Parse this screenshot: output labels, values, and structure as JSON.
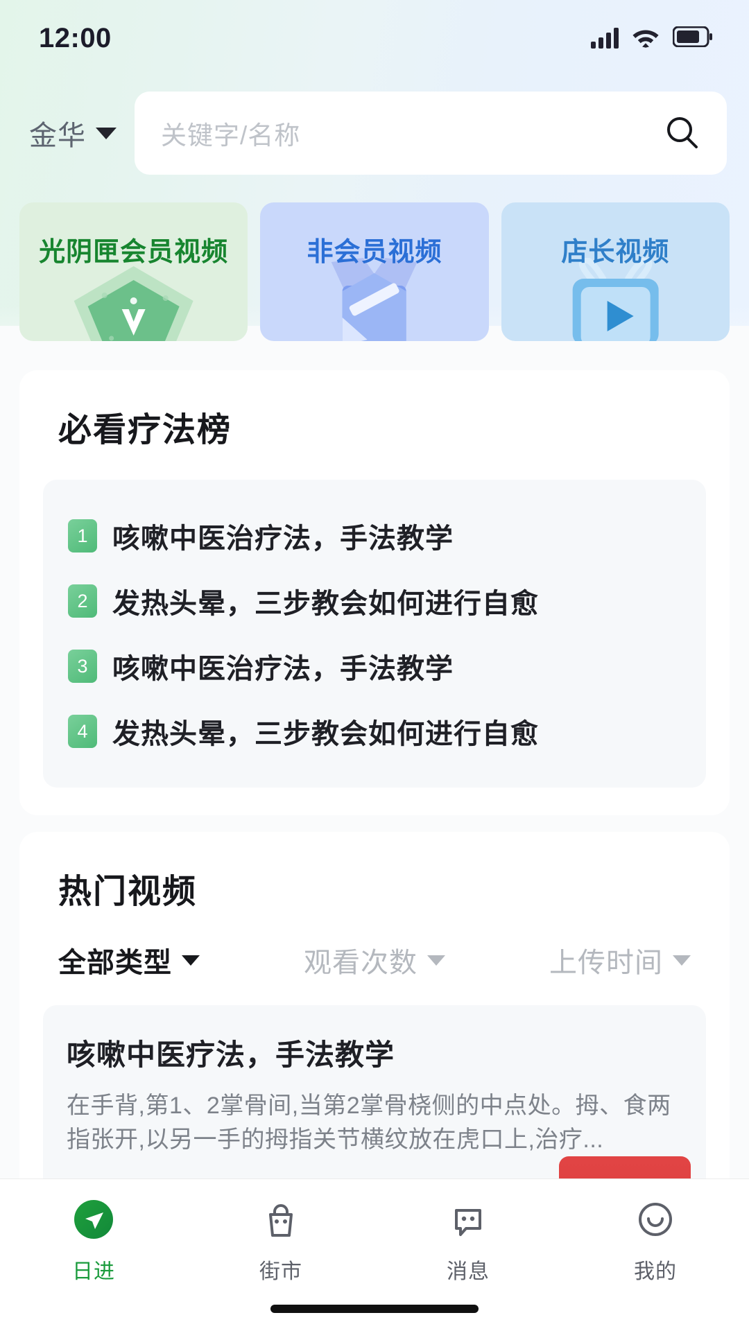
{
  "status_bar": {
    "time": "12:00",
    "icons": [
      "signal-icon",
      "wifi-icon",
      "battery-icon"
    ],
    "battery_level": 70
  },
  "header": {
    "city": "金华",
    "city_caret": "chevron-down-icon",
    "search": {
      "placeholder": "关键字/名称",
      "value": "",
      "icon": "search-icon"
    }
  },
  "categories": [
    {
      "label": "光阴匣会员视频",
      "art": "shield-badge-icon",
      "accent": "#17852f",
      "bg": "#dff0df"
    },
    {
      "label": "非会员视频",
      "art": "package-box-icon",
      "accent": "#2b6fd6",
      "bg": "#c9d8fb"
    },
    {
      "label": "店长视频",
      "art": "tv-play-icon",
      "accent": "#2f7fc9",
      "bg": "#c9e2f7"
    }
  ],
  "ranking_section": {
    "title": "必看疗法榜",
    "items": [
      {
        "rank": "1",
        "text": "咳嗽中医治疗法，手法教学"
      },
      {
        "rank": "2",
        "text": "发热头晕，三步教会如何进行自愈"
      },
      {
        "rank": "3",
        "text": "咳嗽中医治疗法，手法教学"
      },
      {
        "rank": "4",
        "text": "发热头晕，三步教会如何进行自愈"
      }
    ],
    "badge_color": "#4fba78"
  },
  "hot_section": {
    "title": "热门视频",
    "filters": [
      {
        "label": "全部类型",
        "active": true
      },
      {
        "label": "观看次数",
        "active": false
      },
      {
        "label": "上传时间",
        "active": false
      }
    ],
    "videos": [
      {
        "title": "咳嗽中医疗法，手法教学",
        "description": "在手背,第1、2掌骨间,当第2掌骨桡侧的中点处。拇、食两指张开,以另一手的拇指关节横纹放在虎口上,治疗...",
        "action_color": "#e14444"
      }
    ]
  },
  "tabbar": {
    "items": [
      {
        "label": "日进",
        "icon": "navigation-arrow-icon",
        "active": true
      },
      {
        "label": "街市",
        "icon": "shopping-bag-icon",
        "active": false
      },
      {
        "label": "消息",
        "icon": "chat-bubble-icon",
        "active": false
      },
      {
        "label": "我的",
        "icon": "smiley-face-icon",
        "active": false
      }
    ]
  }
}
